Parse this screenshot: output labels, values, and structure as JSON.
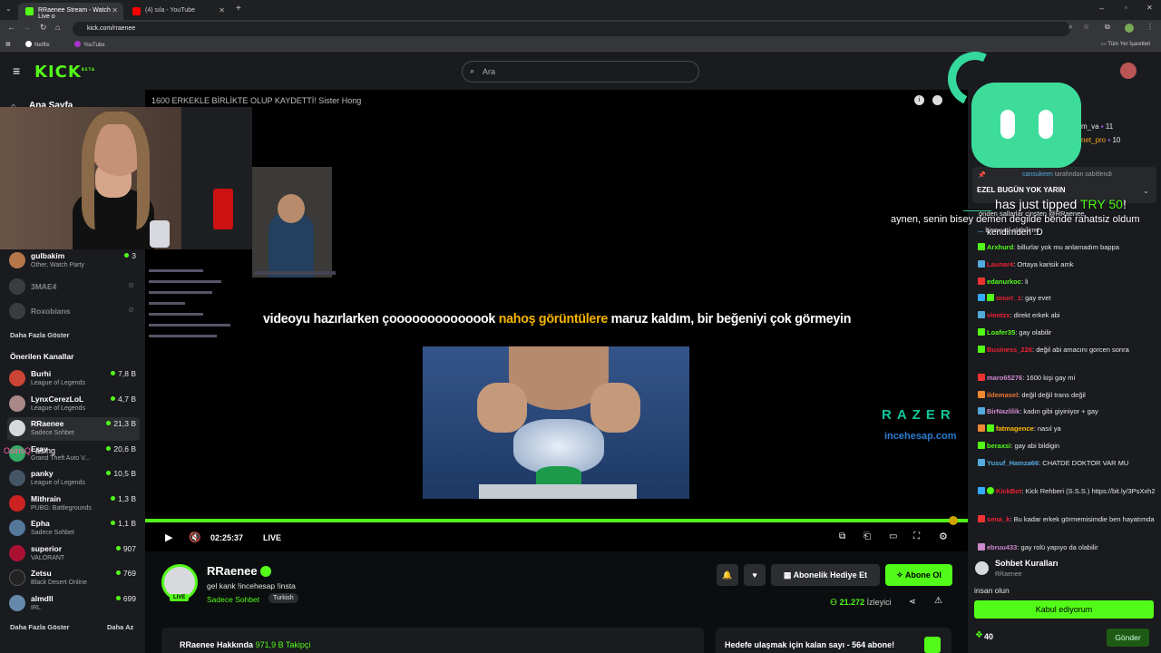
{
  "browser": {
    "tabs": [
      {
        "label": "RRaenee Stream - Watch Live o",
        "active": true,
        "icon": "kick-icon"
      },
      {
        "label": "(4) sıla - YouTube",
        "active": false,
        "icon": "youtube-icon"
      }
    ],
    "url": "kick.com/rraenee",
    "bookmarks": [
      "Netflix",
      "YouTube"
    ],
    "all_bookmarks": "Tüm Yer İşaretleri"
  },
  "header": {
    "logo": "KICK",
    "logo_badge": "BETA",
    "search_placeholder": "Ara"
  },
  "sidebar": {
    "home": "Ana Sayfa",
    "followed": [
      {
        "name": "gulbakim",
        "category": "Other, Watch Party",
        "viewers": "3",
        "color": "#b5774a"
      },
      {
        "name": "3MAE4",
        "category": "",
        "viewers": "",
        "color": "#555"
      },
      {
        "name": "Roxobians",
        "category": "",
        "viewers": "",
        "color": "#555"
      }
    ],
    "show_more": "Daha Fazla Göster",
    "recommended_title": "Önerilen Kanallar",
    "recommended": [
      {
        "name": "Burhi",
        "category": "League of Legends",
        "viewers": "7,8 B",
        "color": "#c43"
      },
      {
        "name": "LynxCerezLoL",
        "category": "League of Legends",
        "viewers": "4,7 B",
        "color": "#a88"
      },
      {
        "name": "RRaenee",
        "category": "Sadece Sohbet",
        "viewers": "21,3 B",
        "color": "#d7d9dc"
      },
      {
        "name": "Eray",
        "category": "Grand Theft Auto V...",
        "viewers": "20,6 B",
        "color": "#3a6"
      },
      {
        "name": "panky",
        "category": "League of Legends",
        "viewers": "10,5 B",
        "color": "#456"
      },
      {
        "name": "Mithrain",
        "category": "PUBG: Battlegrounds",
        "viewers": "1,3 B",
        "color": "#c22"
      },
      {
        "name": "Epha",
        "category": "Sadece Sohbet",
        "viewers": "1,1 B",
        "color": "#579"
      },
      {
        "name": "superior",
        "category": "VALORANT",
        "viewers": "907",
        "color": "#a13"
      },
      {
        "name": "Zetsu",
        "category": "Black Desert Online",
        "viewers": "769",
        "color": "#222"
      },
      {
        "name": "almdll",
        "category": "IRL",
        "viewers": "699",
        "color": "#68a"
      }
    ],
    "show_more_bottom": "Daha Fazla Göster",
    "show_less": "Daha Az",
    "overlay_msg_user": "OsirisQ",
    "overlay_msg_text": ": as hg"
  },
  "player": {
    "video_title": "1600 ERKEKLE BİRLİKTE OLUP KAYDETTİ!  Sister Hong",
    "subtitle_pre": "videoyu hazırlarken çoooooooooooook ",
    "subtitle_hl": "nahoş görüntülere",
    "subtitle_post": " maruz kaldım, bir beğeniyi çok görmeyin",
    "sponsor": "RAZER",
    "sponsor_sub": "incehesap.com",
    "time": "02:25:37",
    "live": "LIVE"
  },
  "stream": {
    "name": "RRaenee",
    "title": "gel kank !incehesap !insta",
    "category": "Sadece Sohbet",
    "language": "Turkish",
    "live_badge": "LIVE",
    "gift_label": "Abonelik Hediye Et",
    "subscribe_label": "Abone Ol",
    "viewers": "21.272",
    "viewers_label": "İzleyici",
    "about": "RRaenee Hakkında",
    "followers": "971,9 B Takipçi",
    "goal": "Hedefe ulaşmak için kalan sayı - 564 abone!"
  },
  "chat": {
    "top_users": [
      {
        "name": "m_va",
        "count": "11"
      },
      {
        "name": "net_pro",
        "count": "10"
      }
    ],
    "pinned_by_user": "cansukeen",
    "pinned_by_text": "tarafından sabitlendi",
    "pinned_title": "EZEL BUGÜN YOK YARIN",
    "pinned_sub": "önden sallarlar cinsten @RRaenee",
    "messages": [
      {
        "user": "...",
        "text": "bisexual olabilirmi",
        "color": "#5ad"
      },
      {
        "user": "Arxhurd",
        "text": ": billurlar yok mu anlamadım bappa",
        "color": "#53fc18"
      },
      {
        "user": "Launar4",
        "text": ": Ortaya karisik amk",
        "color": "#e23"
      },
      {
        "user": "edanurkoc",
        "text": ": li",
        "color": "#53fc18"
      },
      {
        "user": "onurr_1",
        "text": ": gay evet",
        "color": "#e23"
      },
      {
        "user": "vientzx",
        "text": ": direkt erkek abi",
        "color": "#e23"
      },
      {
        "user": "Loafer35",
        "text": ": gay olabilir",
        "color": "#53fc18"
      },
      {
        "user": "Business_226",
        "text": ": değil abi amacını gorcen sonra",
        "color": "#e23"
      },
      {
        "user": "maro65276",
        "text": ": 1600 kişi gay mi",
        "color": "#c8c"
      },
      {
        "user": "ildemasel",
        "text": ": değil değil trans değil",
        "color": "#e73"
      },
      {
        "user": "BirNazlilik",
        "text": ": kadın gibi giyiniyor + gay",
        "color": "#c8c"
      },
      {
        "user": "fatmagence",
        "text": ": nasıl ya",
        "color": "#fb0"
      },
      {
        "user": "beraxsi",
        "text": ": gay abi bildigin",
        "color": "#53fc18"
      },
      {
        "user": "Yusuf_Hamza66",
        "text": ": CHATDE DOKTOR VAR MU",
        "color": "#5ad"
      },
      {
        "user": "KickBot",
        "text": ": Kick Rehberi (S.S.S.) https://bit.ly/3PsXxh2",
        "color": "#e23"
      },
      {
        "user": "sena_k",
        "text": ": Bu kadar erkek görmemisimdie ben hayatımda",
        "color": "#e23"
      },
      {
        "user": "ebruu433",
        "text": ": gay rolü yapıyo da olabilir",
        "color": "#c8c"
      }
    ],
    "rules_title": "Sohbet Kuralları",
    "rules_owner": "RRaenee",
    "rules_body": "insan olun",
    "accept_label": "Kabul ediyorum",
    "points": "40",
    "send_label": "Gönder"
  },
  "tip": {
    "user": "____",
    "text_pre": "has just tipped ",
    "amount": "TRY 50",
    "text_post": "!",
    "message": "aynen, senin bisey demen degilde bende rahatsiz oldum",
    "message2": "kendimden :D"
  },
  "colors": {
    "accent": "#53fc18",
    "bg": "#0b0e0f",
    "panel": "#191b1f"
  }
}
